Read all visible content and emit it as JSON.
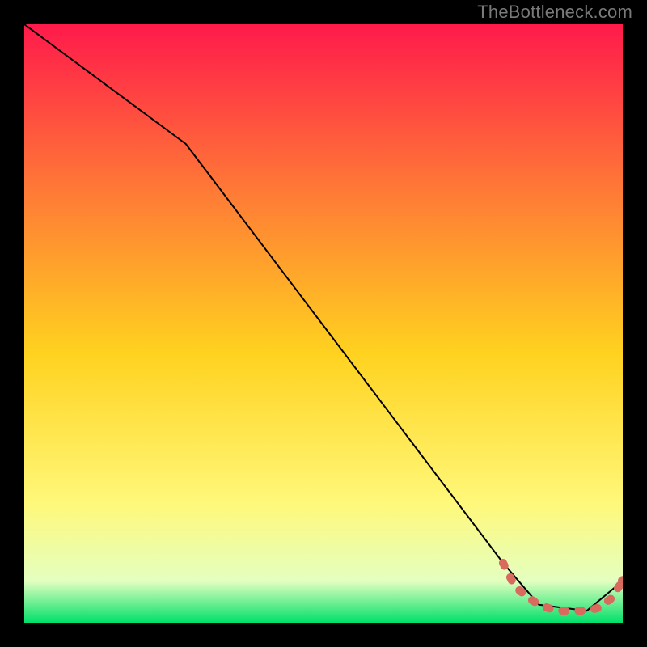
{
  "watermark": "TheBottleneck.com",
  "chart_data": {
    "type": "line",
    "title": "",
    "xlabel": "",
    "ylabel": "",
    "xlim": [
      0,
      100
    ],
    "ylim": [
      0,
      100
    ],
    "grid": false,
    "legend": false,
    "background_gradient": {
      "top": "#ff1a4b",
      "upper_mid": "#ff7a36",
      "mid": "#ffd21f",
      "lower_mid": "#fff87a",
      "lower": "#e4ffc0",
      "bottom": "#00e06a"
    },
    "series": [
      {
        "name": "solid-curve",
        "color": "#000000",
        "style": "solid",
        "x": [
          0,
          27,
          80,
          86,
          94,
          100
        ],
        "y": [
          100,
          80,
          10,
          3,
          2,
          7
        ]
      },
      {
        "name": "dashed-segment",
        "color": "#d86a5e",
        "style": "dashed",
        "x": [
          80,
          82,
          84.5,
          86,
          88,
          90,
          92,
          94,
          96,
          98,
          100
        ],
        "y": [
          10,
          6,
          4,
          3,
          2.3,
          2,
          2,
          2,
          2.5,
          4,
          7
        ]
      }
    ],
    "points": [
      {
        "name": "end-marker",
        "x": 100,
        "y": 7,
        "color": "#d86a5e"
      }
    ]
  }
}
